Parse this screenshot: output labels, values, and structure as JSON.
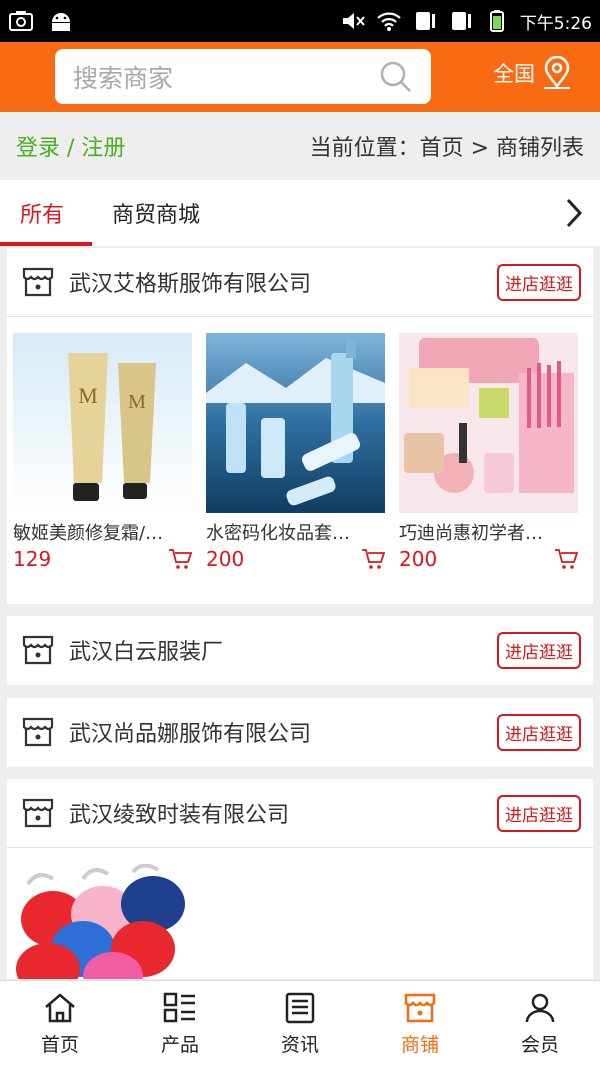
{
  "status_bar": {
    "time": "下午5:26"
  },
  "header": {
    "search_placeholder": "搜索商家",
    "region_label": "全国"
  },
  "breadcrumb": {
    "login_label": "登录 / 注册",
    "location_text": "当前位置：首页 > 商铺列表"
  },
  "tabs": [
    {
      "label": "所有",
      "active": true
    },
    {
      "label": "商贸商城",
      "active": false
    }
  ],
  "shops": [
    {
      "name": "武汉艾格斯服饰有限公司",
      "visit_label": "进店逛逛",
      "products": [
        {
          "name": "敏姬美颜修复霜/…",
          "price": "129"
        },
        {
          "name": "水密码化妆品套…",
          "price": "200"
        },
        {
          "name": "巧迪尚惠初学者…",
          "price": "200"
        }
      ]
    },
    {
      "name": "武汉白云服装厂",
      "visit_label": "进店逛逛",
      "products": []
    },
    {
      "name": "武汉尚品娜服饰有限公司",
      "visit_label": "进店逛逛",
      "products": []
    },
    {
      "name": "武汉绫致时装有限公司",
      "visit_label": "进店逛逛",
      "products": []
    }
  ],
  "bottom_nav": [
    {
      "label": "首页",
      "icon": "home-icon",
      "active": false
    },
    {
      "label": "产品",
      "icon": "product-grid-icon",
      "active": false
    },
    {
      "label": "资讯",
      "icon": "news-icon",
      "active": false
    },
    {
      "label": "商铺",
      "icon": "shop-icon",
      "active": true
    },
    {
      "label": "会员",
      "icon": "user-icon",
      "active": false
    }
  ],
  "colors": {
    "accent": "#f96b12",
    "red": "#d8181c",
    "green": "#4caf1f"
  }
}
